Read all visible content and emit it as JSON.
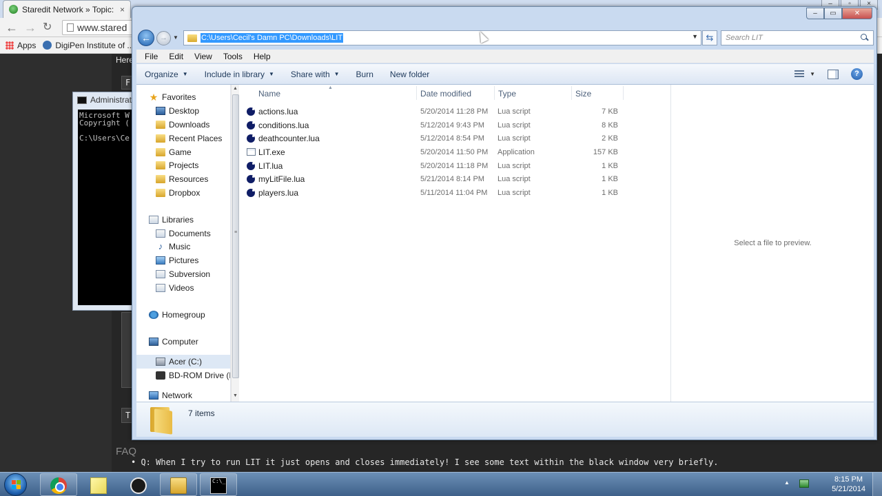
{
  "browser": {
    "tab_title": "Staredit Network » Topic:",
    "tab_close": "×",
    "url": "www.stared",
    "bookmarks": [
      {
        "label": "Apps"
      },
      {
        "label": "DigiPen Institute of ..."
      }
    ],
    "page_snippets": {
      "here": "Here",
      "f": "F",
      "t": "T"
    },
    "faq_title": "FAQ",
    "faq_question": "• Q: When I try to run LIT it just opens and closes immediately! I see some text within the black window very briefly."
  },
  "console": {
    "title": "Administrat",
    "lines": "Microsoft W\nCopyright (\n\nC:\\Users\\Ce"
  },
  "explorer": {
    "address_path": "C:\\Users\\Cecil's Damn PC\\Downloads\\LIT",
    "search_placeholder": "Search LIT",
    "menu": [
      "File",
      "Edit",
      "View",
      "Tools",
      "Help"
    ],
    "commands": [
      {
        "label": "Organize",
        "dropdown": true
      },
      {
        "label": "Include in library",
        "dropdown": true
      },
      {
        "label": "Share with",
        "dropdown": true
      },
      {
        "label": "Burn",
        "dropdown": false
      },
      {
        "label": "New folder",
        "dropdown": false
      }
    ],
    "nav": [
      {
        "label": "Favorites",
        "icon": "star-icon"
      },
      {
        "label": "Desktop",
        "icon": "desktop-icon"
      },
      {
        "label": "Downloads",
        "icon": "folder-icon"
      },
      {
        "label": "Recent Places",
        "icon": "folder-icon"
      },
      {
        "label": "Game",
        "icon": "folder-icon"
      },
      {
        "label": "Projects",
        "icon": "folder-icon"
      },
      {
        "label": "Resources",
        "icon": "folder-icon"
      },
      {
        "label": "Dropbox",
        "icon": "folder-icon"
      },
      {
        "label": "Libraries",
        "icon": "library-icon"
      },
      {
        "label": "Documents",
        "icon": "documents-icon"
      },
      {
        "label": "Music",
        "icon": "music-icon"
      },
      {
        "label": "Pictures",
        "icon": "pictures-icon"
      },
      {
        "label": "Subversion",
        "icon": "library-icon"
      },
      {
        "label": "Videos",
        "icon": "library-icon"
      },
      {
        "label": "Homegroup",
        "icon": "homegroup-icon"
      },
      {
        "label": "Computer",
        "icon": "computer-icon"
      },
      {
        "label": "Acer (C:)",
        "icon": "drive-icon"
      },
      {
        "label": "BD-ROM Drive (E",
        "icon": "bd-rom-icon"
      },
      {
        "label": "Network",
        "icon": "network-icon"
      }
    ],
    "columns": {
      "name": "Name",
      "date": "Date modified",
      "type": "Type",
      "size": "Size"
    },
    "files": [
      {
        "name": "actions.lua",
        "date": "5/20/2014 11:28 PM",
        "type": "Lua script",
        "size": "7 KB",
        "icon": "lua-icon"
      },
      {
        "name": "conditions.lua",
        "date": "5/12/2014 9:43 PM",
        "type": "Lua script",
        "size": "8 KB",
        "icon": "lua-icon"
      },
      {
        "name": "deathcounter.lua",
        "date": "5/12/2014 8:54 PM",
        "type": "Lua script",
        "size": "2 KB",
        "icon": "lua-icon"
      },
      {
        "name": "LIT.exe",
        "date": "5/20/2014 11:50 PM",
        "type": "Application",
        "size": "157 KB",
        "icon": "exe-icon"
      },
      {
        "name": "LIT.lua",
        "date": "5/20/2014 11:18 PM",
        "type": "Lua script",
        "size": "1 KB",
        "icon": "lua-icon"
      },
      {
        "name": "myLitFile.lua",
        "date": "5/21/2014 8:14 PM",
        "type": "Lua script",
        "size": "1 KB",
        "icon": "lua-icon"
      },
      {
        "name": "players.lua",
        "date": "5/11/2014 11:04 PM",
        "type": "Lua script",
        "size": "1 KB",
        "icon": "lua-icon"
      }
    ],
    "preview_text": "Select a file to preview.",
    "item_count": "7 items"
  },
  "taskbar": {
    "time": "8:15 PM",
    "date": "5/21/2014",
    "cmd_icon_text": "C:\\_"
  }
}
